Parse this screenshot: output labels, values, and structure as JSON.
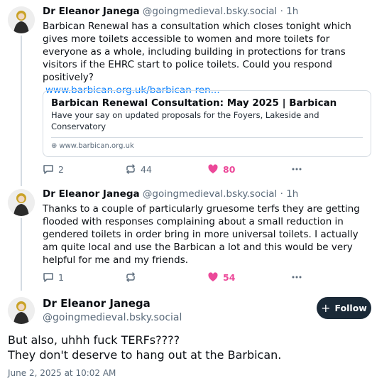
{
  "posts": [
    {
      "author_name": "Dr Eleanor Janega",
      "handle": "@goingmedieval.bsky.social",
      "separator": "·",
      "time": "1h",
      "text": "Barbican Renewal has a consultation which closes tonight which gives more toilets accessible to women and more toilets for everyone as a whole, including building in protections for trans visitors if the EHRC start to police toilets. Could you respond positively?",
      "link_text": "www.barbican.org.uk/barbican-ren...",
      "embed": {
        "title": "Barbican Renewal Consultation: May 2025 | Barbican",
        "description": "Have your say on updated proposals for the Foyers, Lakeside and Conservatory",
        "domain": "www.barbican.org.uk"
      },
      "replies": "2",
      "reposts": "44",
      "likes": "80"
    },
    {
      "author_name": "Dr Eleanor Janega",
      "handle": "@goingmedieval.bsky.social",
      "separator": "·",
      "time": "1h",
      "text": "Thanks to a couple of particularly gruesome terfs they are getting flooded with responses complaining about a small reduction in gendered toilets in order bring in more universal toilets. I actually am quite local and use the Barbican a lot and this would be very helpful for me and my friends.",
      "replies": "1",
      "reposts": "",
      "likes": "54"
    }
  ],
  "main_post": {
    "author_name": "Dr Eleanor Janega",
    "handle": "@goingmedieval.bsky.social",
    "follow_label": "Follow",
    "text_line1": "But also, uhhh fuck TERFs????",
    "text_line2": "They don't deserve to hang out at the Barbican.",
    "date": "June 2, 2025 at 10:02 AM"
  },
  "colors": {
    "link": "#1083fe",
    "like": "#ec4899",
    "muted": "#5b6b7b",
    "follow_bg": "#1b2a38"
  },
  "icons": [
    "reply-icon",
    "repost-icon",
    "heart-icon",
    "more-icon",
    "globe-icon",
    "plus-icon"
  ]
}
